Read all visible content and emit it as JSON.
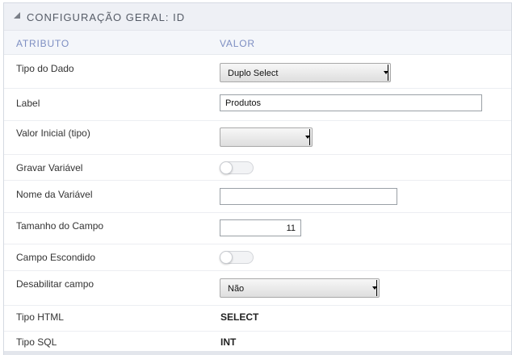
{
  "panel": {
    "title": "CONFIGURAÇÃO GERAL: ID"
  },
  "columns": {
    "attribute": "ATRIBUTO",
    "value": "VALOR"
  },
  "rows": {
    "tipo_dado": {
      "label": "Tipo do Dado",
      "value": "Duplo Select"
    },
    "label": {
      "label": "Label",
      "value": "Produtos"
    },
    "valor_inicial": {
      "label": "Valor Inicial (tipo)",
      "value": ""
    },
    "gravar_variavel": {
      "label": "Gravar Variável",
      "checked": false
    },
    "nome_variavel": {
      "label": "Nome da Variável",
      "value": ""
    },
    "tamanho_campo": {
      "label": "Tamanho do Campo",
      "value": "11"
    },
    "campo_escondido": {
      "label": "Campo Escondido",
      "checked": false
    },
    "desabilitar_campo": {
      "label": "Desabilitar campo",
      "value": "Não"
    },
    "tipo_html": {
      "label": "Tipo HTML",
      "value": "SELECT"
    },
    "tipo_sql": {
      "label": "Tipo SQL",
      "value": "INT"
    }
  },
  "icons": {
    "collapse": "collapse-triangle-icon",
    "select_arrow": "dropdown-arrow-icon"
  }
}
